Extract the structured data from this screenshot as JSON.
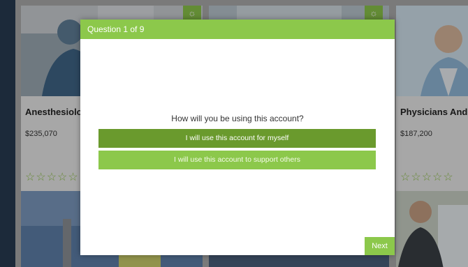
{
  "background": {
    "cards": [
      {
        "title": "Anesthesiolo",
        "salary": "$235,070",
        "stars": "☆☆☆☆☆"
      },
      {
        "title": "Physicians And S",
        "salary": "$187,200",
        "stars": "☆☆☆☆☆"
      }
    ],
    "badge_icon": "☼"
  },
  "modal": {
    "header": "Question 1 of 9",
    "question": "How will you be using this account?",
    "options": [
      {
        "label": "I will use this account for myself",
        "selected": true
      },
      {
        "label": "I will use this account to support others",
        "selected": false
      }
    ],
    "next_label": "Next"
  },
  "colors": {
    "accent": "#8cc84b",
    "selected_option": "#6a9a2d"
  }
}
